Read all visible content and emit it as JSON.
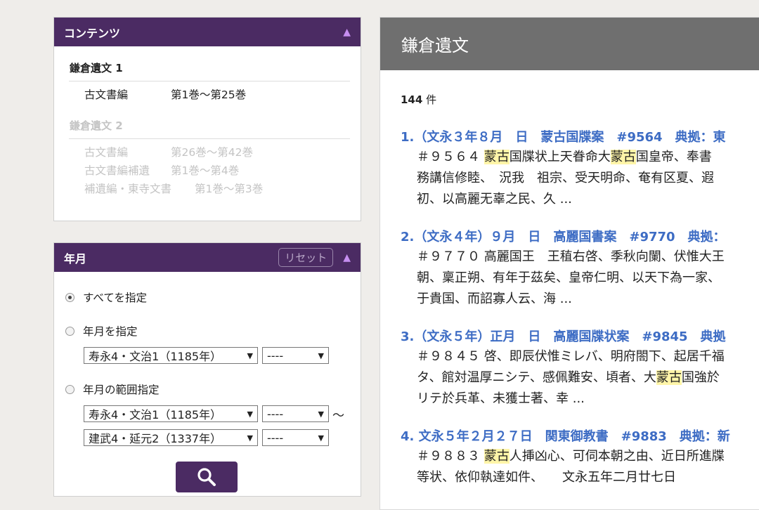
{
  "contents_panel": {
    "title": "コンテンツ",
    "sections": [
      {
        "title": "鎌倉遺文 1",
        "rows": [
          {
            "name": "古文書編",
            "range": "第1巻〜第25巻"
          }
        ]
      },
      {
        "title": "鎌倉遺文 2",
        "rows": [
          {
            "name": "古文書編",
            "range": "第26巻〜第42巻"
          },
          {
            "name": "古文書編補遺",
            "range": "第1巻〜第4巻"
          },
          {
            "name": "補遺編・東寺文書",
            "range": "第1巻〜第3巻"
          }
        ]
      }
    ]
  },
  "date_panel": {
    "title": "年月",
    "reset_label": "リセット",
    "radio_all": "すべてを指定",
    "radio_month": "年月を指定",
    "radio_range": "年月の範囲指定",
    "era_start": "寿永4・文治1（1185年）",
    "era_end": "建武4・延元2（1337年）",
    "month_placeholder": "----",
    "range_sep": "〜",
    "selected_radio": "all"
  },
  "main": {
    "title": "鎌倉遺文",
    "count_number": "144",
    "count_unit": "件",
    "results": [
      {
        "title": "1.（文永３年８月　日　蒙古国牒案　#9564　典拠：東",
        "lines": [
          [
            "＃９５６４ ",
            "蒙古",
            "国牒状上天眷命大",
            "蒙古",
            "国皇帝、奉書"
          ],
          [
            "務講信修睦、　況我　祖宗、受天明命、奄有区夏、遐"
          ],
          [
            "初、以高麗无辜之民、久 ..."
          ]
        ]
      },
      {
        "title": "2.（文永４年）９月　日　高麗国書案　#9770　典拠：",
        "lines": [
          [
            "＃９７７０ 高麗国王　王稙右啓、季秋向闌、伏惟大王"
          ],
          [
            "朝、稟正朔、有年于茲矣、皇帝仁明、以天下為一家、"
          ],
          [
            "于貴国、而詔寡人云、海 ..."
          ]
        ]
      },
      {
        "title": "3.（文永５年）正月　日　高麗国牒状案　#9845　典拠",
        "lines": [
          [
            "＃９８４５ 啓、即辰伏惟ミレバ、明府閤下、起居千福"
          ],
          [
            "タ、館対温厚ニシテ、感佩難安、頃者、大",
            "蒙古",
            "国強於"
          ],
          [
            "リテ於兵革、未獲士著、幸 ..."
          ]
        ]
      },
      {
        "title": "4. 文永５年２月２７日　関東御教書　#9883　典拠：新",
        "lines": [
          [
            "＃９８８３ ",
            "蒙古",
            "人挿凶心、可伺本朝之由、近日所進牒"
          ],
          [
            "等状、依仰執達如件、　　文永五年二月廿七日"
          ]
        ]
      }
    ]
  },
  "colors": {
    "header_purple": "#4b2b63",
    "link_blue": "#3d6cc4",
    "highlight": "#fff5a8",
    "main_header": "#6f6f6f"
  },
  "icons": {
    "collapse": "triangle-up-icon",
    "search": "magnifier-icon",
    "select": "dropdown-arrow-icon"
  }
}
